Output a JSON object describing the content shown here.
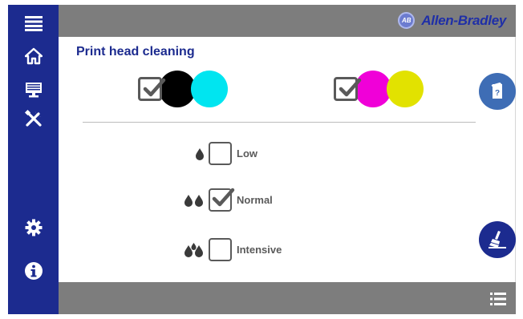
{
  "brand": {
    "name": "Allen-Bradley",
    "logo_text": "AB"
  },
  "page": {
    "title": "Print head cleaning"
  },
  "sidebar": {
    "items": [
      {
        "icon": "menu-icon"
      },
      {
        "icon": "home-icon"
      },
      {
        "icon": "monitor-icon"
      },
      {
        "icon": "tools-icon"
      },
      {
        "icon": "gear-icon"
      },
      {
        "icon": "info-icon"
      }
    ]
  },
  "ink_groups": [
    {
      "checked": true,
      "colors": [
        "#000000",
        "#00e5f0"
      ]
    },
    {
      "checked": true,
      "colors": [
        "#f000d8",
        "#e2e200"
      ]
    }
  ],
  "cleaning_options": [
    {
      "label": "Low",
      "drops_icon": "single-drop-icon",
      "checked": false
    },
    {
      "label": "Normal",
      "drops_icon": "double-drop-icon",
      "checked": true
    },
    {
      "label": "Intensive",
      "drops_icon": "triple-drop-icon",
      "checked": false
    }
  ],
  "actions": {
    "doc_icon": "document-icon",
    "clean_icon": "cleaning-icon",
    "list_icon": "list-icon"
  },
  "colors": {
    "sidebar": "#1c2b8f",
    "bars": "#7d7d7d",
    "title": "#1c2b8f"
  }
}
